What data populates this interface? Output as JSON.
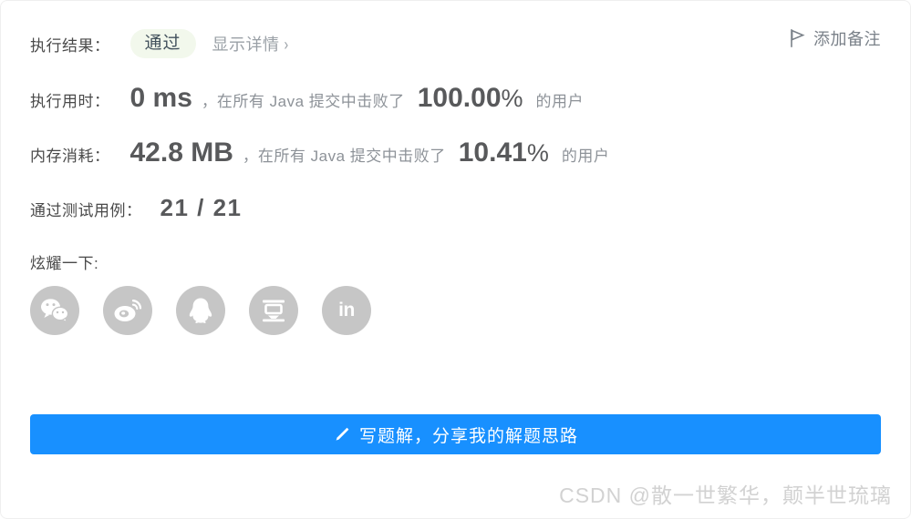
{
  "card": {
    "status_row": {
      "label": "执行结果：",
      "badge": "通过",
      "detail_link": "显示详情",
      "chevron": "›",
      "note_button": "添加备注"
    },
    "runtime_row": {
      "label": "执行用时：",
      "value": "0 ms",
      "comma": "，",
      "mid_text": "在所有 Java 提交中击败了",
      "percent": "100.00",
      "percent_sign": "%",
      "tail_text": "的用户"
    },
    "memory_row": {
      "label": "内存消耗：",
      "value": "42.8 MB",
      "comma": "，",
      "mid_text": "在所有 Java 提交中击败了",
      "percent": "10.41",
      "percent_sign": "%",
      "tail_text": "的用户"
    },
    "cases_row": {
      "label": "通过测试用例：",
      "value": "21 / 21"
    },
    "share": {
      "title": "炫耀一下:",
      "icons": [
        {
          "name": "wechat",
          "label": "微信"
        },
        {
          "name": "weibo",
          "label": "微博"
        },
        {
          "name": "qq",
          "label": "QQ"
        },
        {
          "name": "douban",
          "label": "豆瓣"
        },
        {
          "name": "linkedin",
          "label": "in"
        }
      ]
    },
    "cta": {
      "label": "写题解，分享我的解题思路",
      "icon": "pencil-icon"
    },
    "watermark": "CSDN @散一世繁华，颠半世琉璃",
    "colors": {
      "accent_blue": "#1890ff",
      "badge_bg": "#f2f8ec",
      "value_gray": "#58595b",
      "muted_gray": "#8d9298",
      "icon_gray": "#c6c6c6",
      "watermark_gray": "#d2d2d2"
    }
  }
}
